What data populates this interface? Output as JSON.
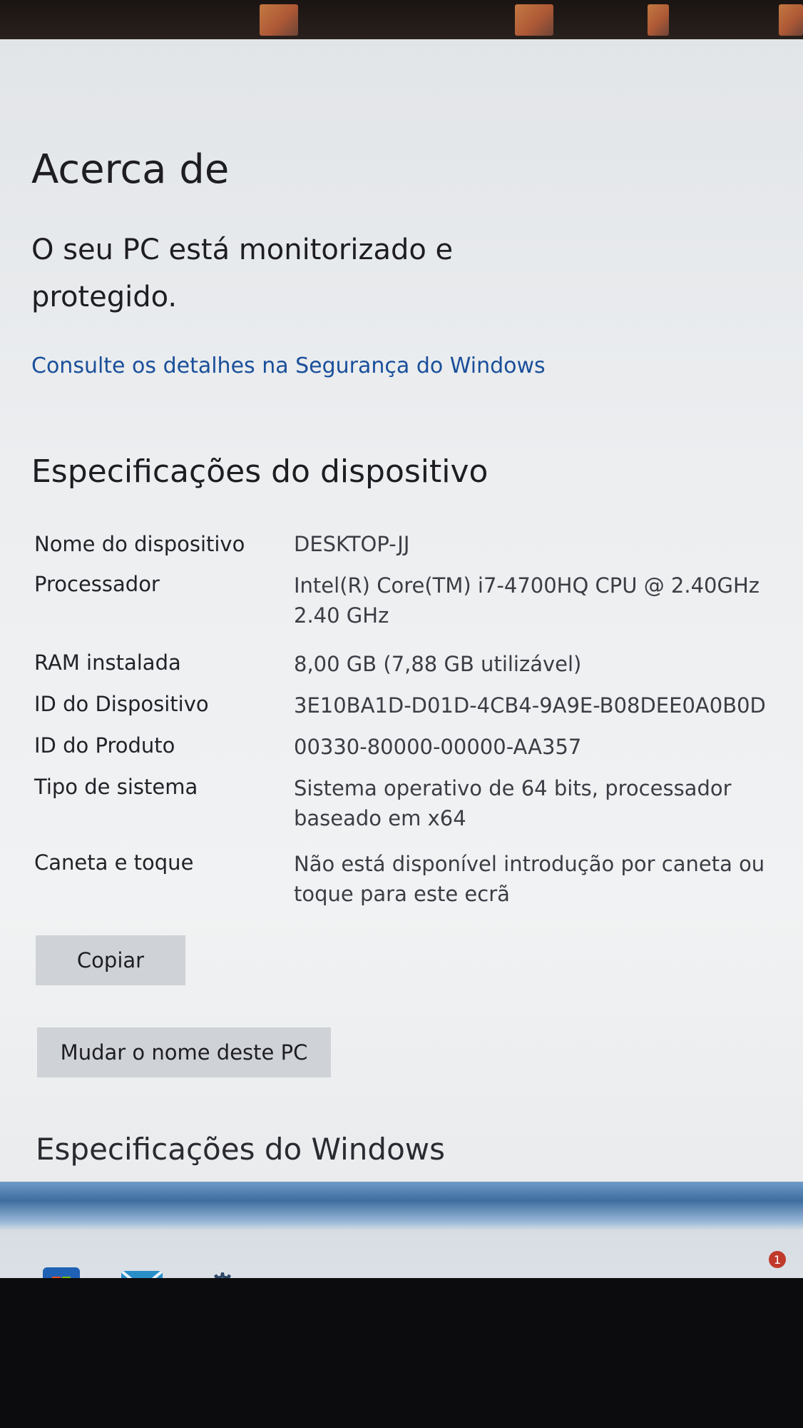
{
  "page": {
    "title": "Acerca de",
    "status_heading": "O seu PC está monitorizado e protegido.",
    "security_link": "Consulte os detalhes na Segurança do Windows"
  },
  "device_specs": {
    "heading": "Especificações do dispositivo",
    "rows": [
      {
        "label": "Nome do dispositivo",
        "value": "DESKTOP-JJ"
      },
      {
        "label": "Processador",
        "value": "Intel(R) Core(TM) i7-4700HQ CPU @ 2.40GHz 2.40 GHz"
      },
      {
        "label": "RAM instalada",
        "value": "8,00 GB (7,88 GB utilizável)"
      },
      {
        "label": "ID do Dispositivo",
        "value": "3E10BA1D-D01D-4CB4-9A9E-B08DEE0A0B0D"
      },
      {
        "label": "ID do Produto",
        "value": "00330-80000-00000-AA357"
      },
      {
        "label": "Tipo de sistema",
        "value": "Sistema operativo de 64 bits, processador baseado em x64"
      },
      {
        "label": "Caneta e toque",
        "value": "Não está disponível introdução por caneta ou toque para este ecrã"
      }
    ],
    "copy_button": "Copiar",
    "rename_button": "Mudar o nome deste PC"
  },
  "windows_specs": {
    "heading": "Especificações do Windows"
  },
  "taskbar": {
    "icons": [
      "store-icon",
      "mail-icon",
      "settings-gear-icon"
    ],
    "notification_count": "1",
    "accent_color": "#3e6e9f"
  }
}
